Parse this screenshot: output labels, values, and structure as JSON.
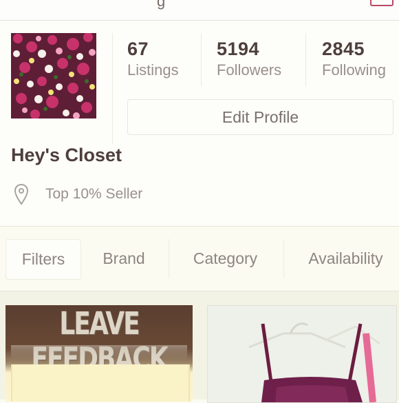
{
  "header": {
    "title_fragment": "g"
  },
  "profile": {
    "stats": [
      {
        "value": "67",
        "label": "Listings"
      },
      {
        "value": "5194",
        "label": "Followers"
      },
      {
        "value": "2845",
        "label": "Following"
      }
    ],
    "edit_button_label": "Edit Profile",
    "closet_name": "Hey's Closet",
    "seller_badge": "Top 10% Seller",
    "avatar_icon": "flowers-photo",
    "location_icon": "map-pin-icon"
  },
  "filters": {
    "tabs": [
      {
        "label": "Filters",
        "active": true
      },
      {
        "label": "Brand",
        "active": false
      },
      {
        "label": "Category",
        "active": false
      },
      {
        "label": "Availability",
        "active": false
      }
    ]
  },
  "listings": [
    {
      "image_text": "LEAVE FEEDBACK"
    },
    {
      "image_icon": "dress-on-hanger-photo"
    }
  ],
  "colors": {
    "accent": "#b84a62",
    "text_dark": "#4e3f3b",
    "text_muted": "#9a908b",
    "background": "#fbfbf4"
  }
}
